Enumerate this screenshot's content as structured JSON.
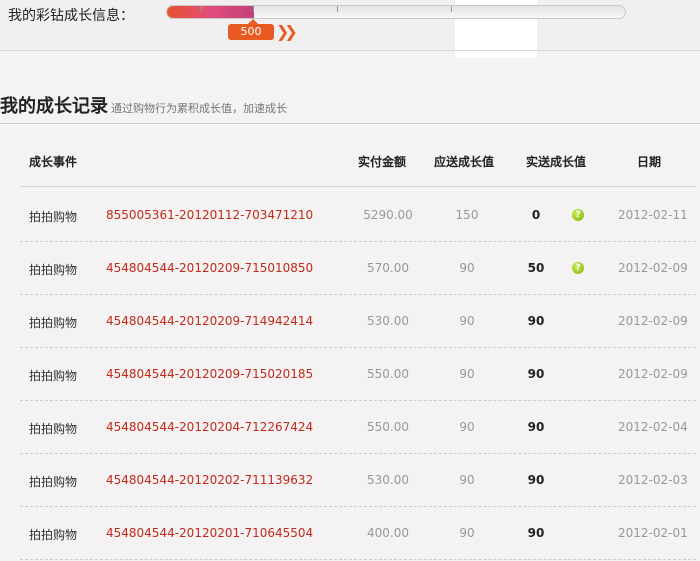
{
  "growth_info": {
    "label": "我的彩钻成长信息：",
    "progress_fraction": 0.19,
    "current_value": "500"
  },
  "section": {
    "title": "我的成长记录",
    "subtitle": "通过购物行为累积成长值，加速成长"
  },
  "table": {
    "headers": {
      "event": "成长事件",
      "paid": "实付金额",
      "due": "应送成长值",
      "sent": "实送成长值",
      "date": "日期"
    },
    "rows": [
      {
        "event": "拍拍购物",
        "order": "855005361-20120112-703471210",
        "paid": "5290.00",
        "due": "150",
        "sent": "0",
        "help": true,
        "date": "2012-02-11"
      },
      {
        "event": "拍拍购物",
        "order": "454804544-20120209-715010850",
        "paid": "570.00",
        "due": "90",
        "sent": "50",
        "help": true,
        "date": "2012-02-09"
      },
      {
        "event": "拍拍购物",
        "order": "454804544-20120209-714942414",
        "paid": "530.00",
        "due": "90",
        "sent": "90",
        "help": false,
        "date": "2012-02-09"
      },
      {
        "event": "拍拍购物",
        "order": "454804544-20120209-715020185",
        "paid": "550.00",
        "due": "90",
        "sent": "90",
        "help": false,
        "date": "2012-02-09"
      },
      {
        "event": "拍拍购物",
        "order": "454804544-20120204-712267424",
        "paid": "550.00",
        "due": "90",
        "sent": "90",
        "help": false,
        "date": "2012-02-04"
      },
      {
        "event": "拍拍购物",
        "order": "454804544-20120202-711139632",
        "paid": "530.00",
        "due": "90",
        "sent": "90",
        "help": false,
        "date": "2012-02-03"
      },
      {
        "event": "拍拍购物",
        "order": "454804544-20120201-710645504",
        "paid": "400.00",
        "due": "90",
        "sent": "90",
        "help": false,
        "date": "2012-02-01"
      }
    ]
  },
  "colors": {
    "order_link": "#c22a1a",
    "marker": "#e85a22",
    "help_icon": "#8cc21e"
  }
}
